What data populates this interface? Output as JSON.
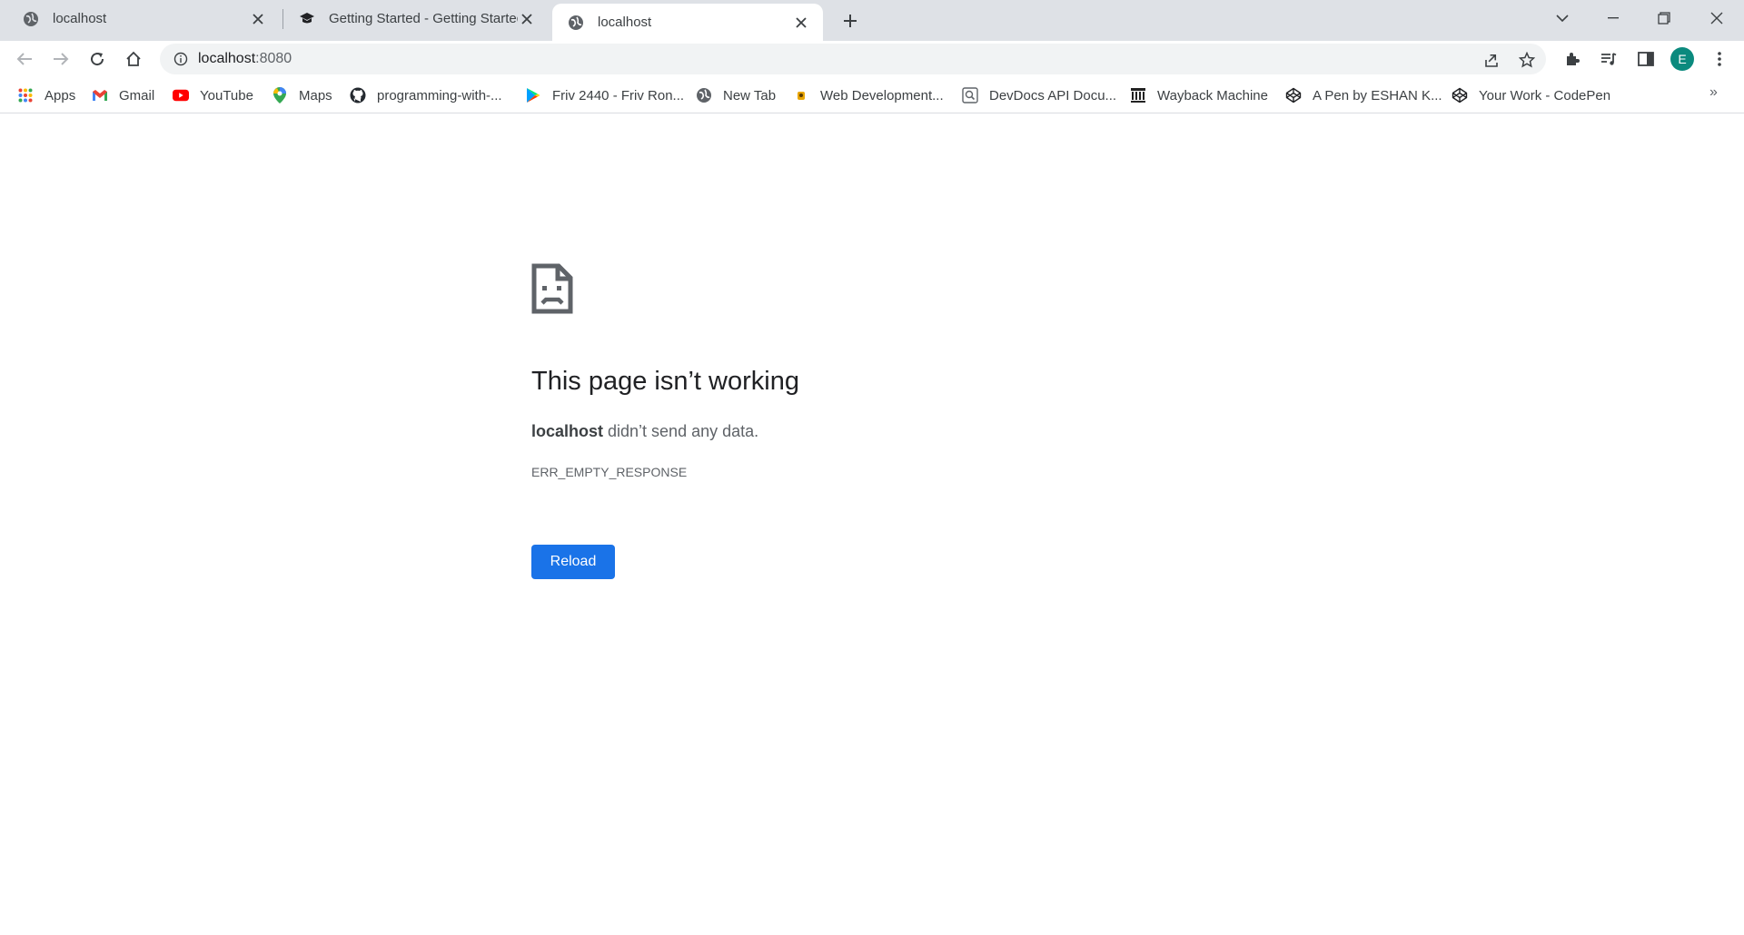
{
  "tabs": [
    {
      "title": "localhost",
      "favicon": "globe-icon",
      "active": false
    },
    {
      "title": "Getting Started - Getting Started",
      "favicon": "graduation-cap-icon",
      "active": false
    },
    {
      "title": "localhost",
      "favicon": "globe-icon",
      "active": true
    }
  ],
  "address_bar": {
    "host": "localhost",
    "port": ":8080"
  },
  "profile": {
    "initial": "E",
    "color": "#0b8a7e"
  },
  "bookmarks": [
    {
      "label": "Apps",
      "icon": "apps-grid-icon"
    },
    {
      "label": "Gmail",
      "icon": "gmail-icon"
    },
    {
      "label": "YouTube",
      "icon": "youtube-icon"
    },
    {
      "label": "Maps",
      "icon": "maps-pin-icon"
    },
    {
      "label": "programming-with-...",
      "icon": "github-icon"
    },
    {
      "label": "Friv 2440 - Friv Ron...",
      "icon": "play-store-icon"
    },
    {
      "label": "New Tab",
      "icon": "globe-icon"
    },
    {
      "label": "Web Development...",
      "icon": "bookmark-favicon-icon"
    },
    {
      "label": "DevDocs API Docu...",
      "icon": "devdocs-icon"
    },
    {
      "label": "Wayback Machine",
      "icon": "wayback-icon"
    },
    {
      "label": "A Pen by ESHAN K...",
      "icon": "codepen-icon"
    },
    {
      "label": "Your Work - CodePen",
      "icon": "codepen-icon"
    }
  ],
  "error_page": {
    "heading": "This page isn’t working",
    "host": "localhost",
    "message": " didn’t send any data.",
    "error_code": "ERR_EMPTY_RESPONSE",
    "reload_label": "Reload",
    "accent": "#1a73e8"
  }
}
